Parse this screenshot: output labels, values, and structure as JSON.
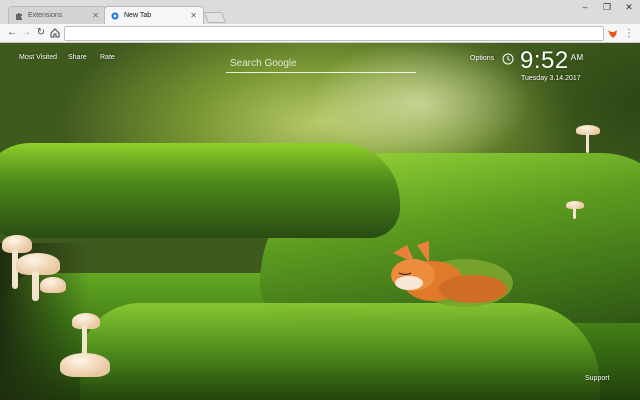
{
  "browser": {
    "tabs": [
      {
        "label": "Extensions",
        "icon": "puzzle-icon",
        "active": false
      },
      {
        "label": "New Tab",
        "icon": "chrome-icon",
        "active": true
      }
    ],
    "address": {
      "value": "",
      "placeholder": ""
    },
    "window_controls": {
      "minimize": "–",
      "maximize": "❐",
      "close": "✕"
    }
  },
  "newtab": {
    "links": {
      "most_visited": "Most Visited",
      "share": "Share",
      "rate": "Rate"
    },
    "search": {
      "placeholder": "Search Google"
    },
    "options_label": "Options",
    "time": "9:52",
    "ampm": "AM",
    "date": "Tuesday  3.14.2017",
    "support_label": "Support"
  },
  "colors": {
    "accent": "#e8581c",
    "moss": "#6fb22a",
    "overlay_text": "#ffffff"
  }
}
